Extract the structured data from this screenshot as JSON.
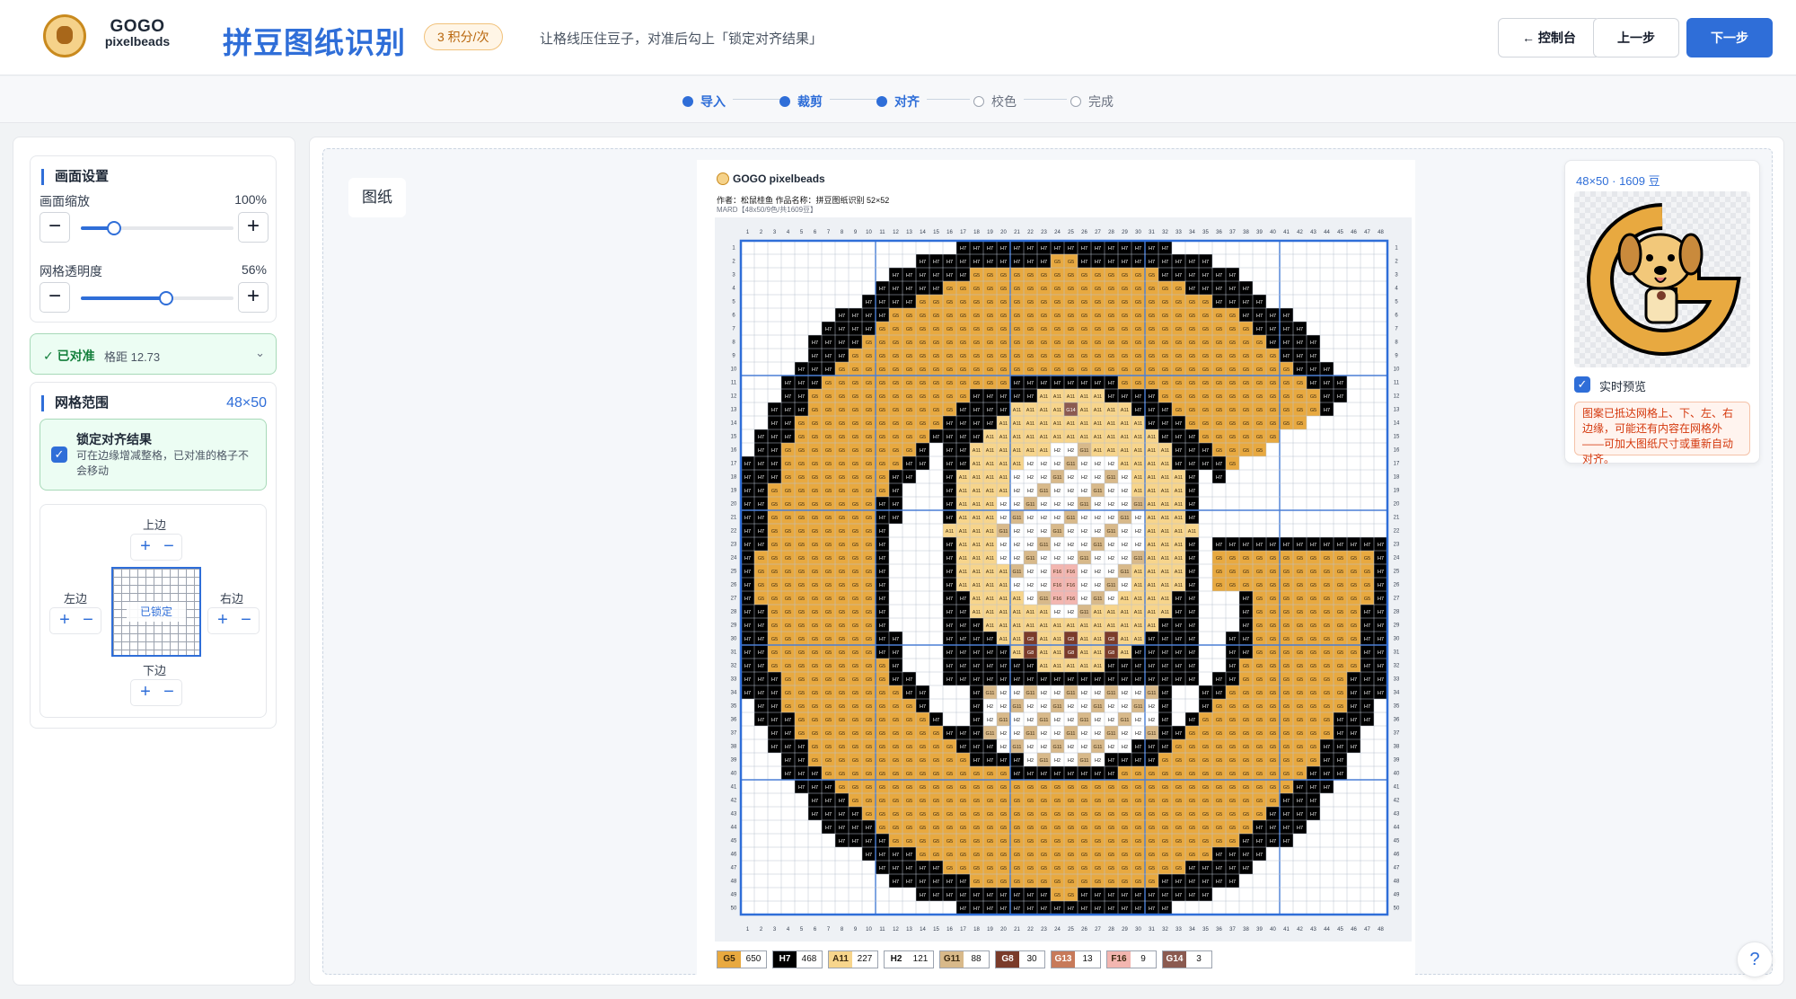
{
  "header": {
    "logo_line1": "GOGO",
    "logo_line2": "pixelbeads",
    "app_title": "拼豆图纸识别",
    "cost_badge": "3 积分/次",
    "hint": "让格线压住豆子，对准后勾上「锁定对齐结果」",
    "btn_dashboard": "← 控制台",
    "btn_prev": "上一步",
    "btn_next": "下一步"
  },
  "steps": [
    {
      "label": "导入",
      "done": true
    },
    {
      "label": "裁剪",
      "done": true
    },
    {
      "label": "对齐",
      "done": true
    },
    {
      "label": "校色",
      "done": false
    },
    {
      "label": "完成",
      "done": false
    }
  ],
  "sidebar": {
    "canvas_settings": {
      "title": "画面设置",
      "zoom_label": "画面缩放",
      "zoom_value": "100%",
      "zoom_fraction": 0.22,
      "grid_opacity_label": "网格透明度",
      "grid_opacity_value": "56%",
      "grid_opacity_fraction": 0.56
    },
    "aligned": {
      "status": "✓ 已对准",
      "spacing": "格距 12.73",
      "chevron": "⌄"
    },
    "grid_range": {
      "title": "网格范围",
      "size": "48×50",
      "lock_title": "锁定对齐结果",
      "lock_desc": "可在边缘增减整格，已对准的格子不会移动",
      "lock_checked": true,
      "top_label": "上边",
      "bottom_label": "下边",
      "left_label": "左边",
      "right_label": "右边",
      "locked_text": "已锁定",
      "plus": "+",
      "minus": "−"
    }
  },
  "main": {
    "paper_tag": "图纸",
    "sheet": {
      "title": "GOGO pixelbeads",
      "meta": "作者：松鼠桂鱼   作品名称：拼豆图纸识别 52×52",
      "meta2": "MARD【48x50/9色/共1609豆】"
    },
    "legend": [
      {
        "code": "G5",
        "count": "650",
        "color": "#e8a940",
        "text": "#3b2a10"
      },
      {
        "code": "H7",
        "count": "468",
        "color": "#000000",
        "text": "#ffffff"
      },
      {
        "code": "A11",
        "count": "227",
        "color": "#f7d58c",
        "text": "#3b2a10"
      },
      {
        "code": "H2",
        "count": "121",
        "color": "#ffffff",
        "text": "#111111"
      },
      {
        "code": "G11",
        "count": "88",
        "color": "#d8b98a",
        "text": "#3b2a10"
      },
      {
        "code": "G8",
        "count": "30",
        "color": "#7a3b2a",
        "text": "#ffffff"
      },
      {
        "code": "G13",
        "count": "13",
        "color": "#c77a5a",
        "text": "#ffffff"
      },
      {
        "code": "F16",
        "count": "9",
        "color": "#f3b6b0",
        "text": "#3b2a10"
      },
      {
        "code": "G14",
        "count": "3",
        "color": "#8b5a50",
        "text": "#ffffff"
      }
    ]
  },
  "preview": {
    "title": "48×50 · 1609 豆",
    "realtime_label": "实时预览",
    "realtime_checked": true,
    "warning": "图案已抵达网格上、下、左、右边缘，可能还有内容在网格外——可加大图纸尺寸或重新自动对齐。"
  },
  "help_icon": "?",
  "colors": {
    "accent": "#2f6ed8",
    "success": "#15803d",
    "warning": "#d4380d"
  }
}
